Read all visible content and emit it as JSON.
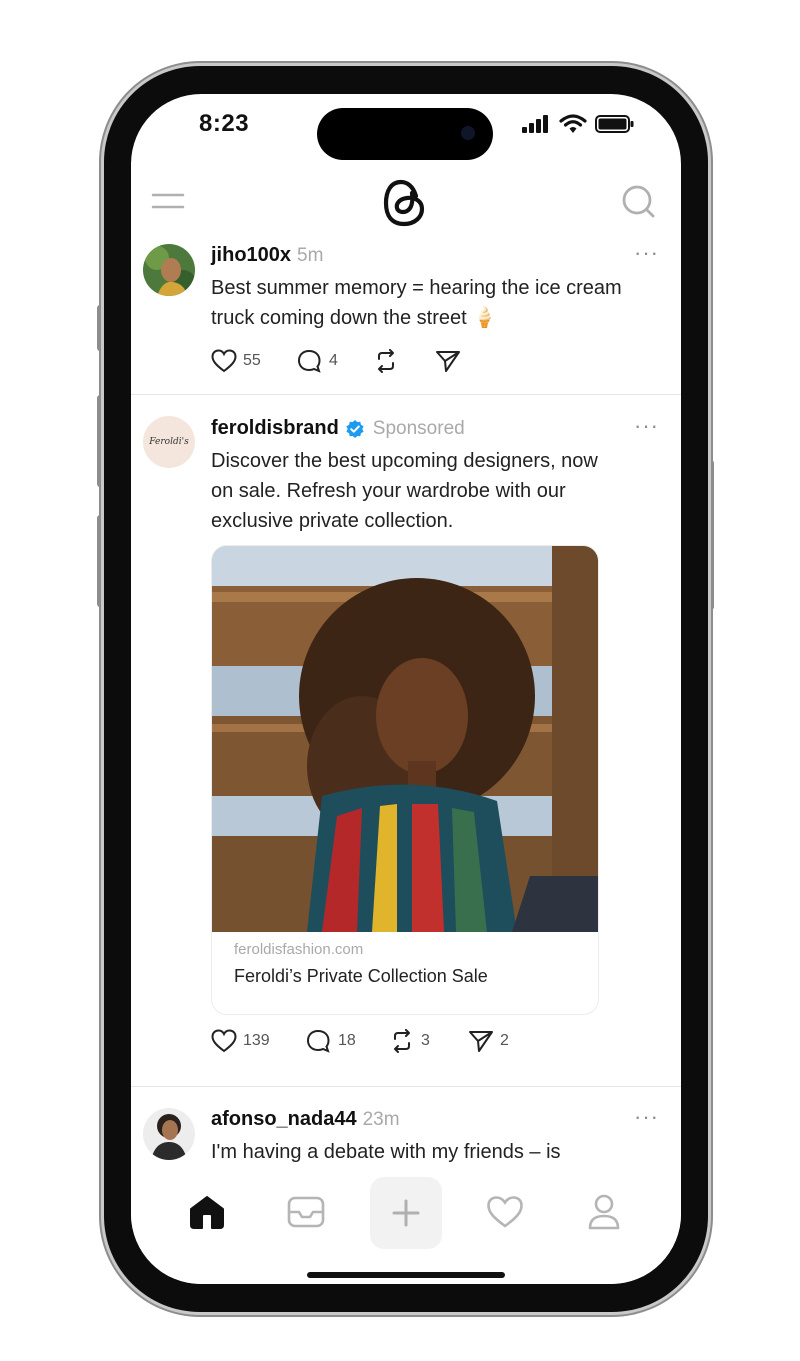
{
  "status_bar": {
    "time": "8:23"
  },
  "header": {
    "logo": "threads-logo",
    "menu_icon": "menu-icon",
    "search_icon": "search-icon"
  },
  "posts": [
    {
      "username": "jiho100x",
      "time": "5m",
      "text_line1": "Best summer memory = hearing the ice cream",
      "text_line2": "truck coming down the street 🍦",
      "likes": "55",
      "replies": "4"
    },
    {
      "username": "feroldisbrand",
      "avatar_text": "Feroldi's",
      "verified": true,
      "label": "Sponsored",
      "text_line1": "Discover the best upcoming designers, now",
      "text_line2": "on sale. Refresh your wardrobe with our",
      "text_line3": "exclusive private collection.",
      "link_domain": "feroldisfashion.com",
      "link_title": "Feroldi’s Private Collection Sale",
      "likes": "139",
      "replies": "18",
      "reposts": "3",
      "shares": "2"
    },
    {
      "username": "afonso_nada44",
      "time": "23m",
      "text_line1": "I'm having a debate with my friends – is"
    }
  ],
  "bottom_nav": [
    "home-icon",
    "inbox-icon",
    "compose-icon",
    "activity-icon",
    "profile-icon"
  ],
  "colors": {
    "verified": "#1d9bf0",
    "text": "#111111",
    "muted": "#a9a9a9"
  }
}
